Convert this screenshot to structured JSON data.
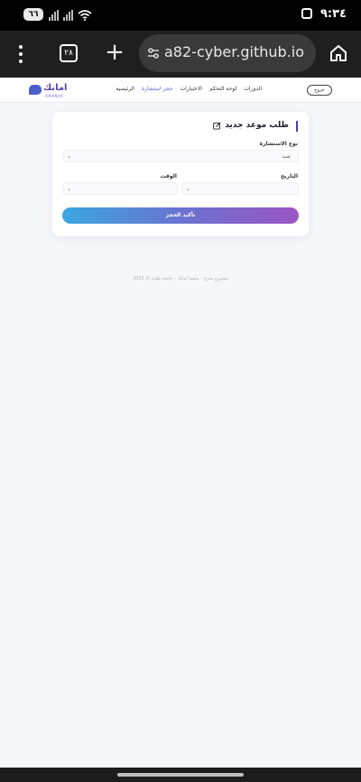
{
  "status_bar": {
    "battery": "٦٦",
    "time": "٩:٣٤"
  },
  "browser": {
    "tab_count": "٢٨",
    "url": "a82-cyber.github.io"
  },
  "site_nav": {
    "logout_label": "خروج",
    "links": [
      {
        "label": "الرئيسية",
        "active": false
      },
      {
        "label": "حجز استشارة",
        "active": true
      },
      {
        "label": "الاختبارات",
        "active": false
      },
      {
        "label": "لوحة التحكم",
        "active": false
      },
      {
        "label": "الدورات",
        "active": false
      }
    ],
    "logo_text": "امانك",
    "logo_sub": "AMANAK"
  },
  "booking_form": {
    "title": "طلب موعد جديد",
    "consultation_type_label": "نوع الاستشارة",
    "consultation_type_value": "تقنية",
    "date_label": "التاريخ",
    "date_value": "",
    "time_label": "الوقت",
    "time_value": "",
    "confirm_label": "تأكيد الحجز"
  },
  "footer": {
    "text": "مشروع تخرج - منصة امانك - جامعة طيبة © 2025"
  },
  "colors": {
    "accent": "#5b64d6",
    "gradient_start": "#3ba6e0",
    "gradient_end": "#9b55c4"
  }
}
